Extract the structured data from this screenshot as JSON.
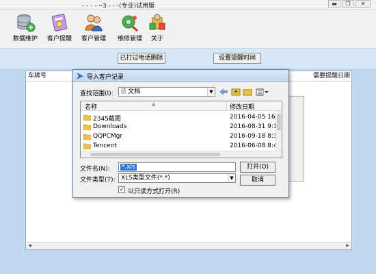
{
  "window": {
    "title": "(专业)试用版",
    "title_prefix": "- - - - ꞏꞏ3 - - -"
  },
  "toolbar": {
    "items": [
      {
        "label": "数据维护",
        "icon": "database-icon"
      },
      {
        "label": "客户提醒",
        "icon": "reminder-icon"
      },
      {
        "label": "客户管理",
        "icon": "users-icon"
      },
      {
        "label": "维修管理",
        "icon": "repair-icon"
      },
      {
        "label": "关于",
        "icon": "about-icon"
      }
    ]
  },
  "actions": {
    "called_delete": "已打过电话删除",
    "set_reminder_time": "设置提醒时间"
  },
  "grid": {
    "col_plate": "车牌号",
    "col_reminder_date": "需要提醒日期"
  },
  "dialog": {
    "title": "导入客户记录",
    "look_in_label": "查找范围(I):",
    "look_in_value": "文档",
    "col_name": "名称",
    "col_modified": "修改日期",
    "files": [
      {
        "name": "2345截图",
        "date": "2016-04-05 16:3"
      },
      {
        "name": "Downloads",
        "date": "2016-08-31 9:1"
      },
      {
        "name": "QQPCMgr",
        "date": "2016-09-18 8:3"
      },
      {
        "name": "Tencent",
        "date": "2016-06-08 8:4"
      }
    ],
    "filename_label": "文件名(N):",
    "filename_value": "*.xls",
    "filetype_label": "文件类型(T):",
    "filetype_value": "XLS类型文件(*.*)",
    "readonly_label": "以只读方式打开(R)",
    "readonly_checked": "✓",
    "open_button": "打开(O)",
    "cancel_button": "取消"
  },
  "colors": {
    "dialog_border": "#5c7fa6",
    "selection": "#3078d6",
    "app_background": "#bfd7ef"
  }
}
